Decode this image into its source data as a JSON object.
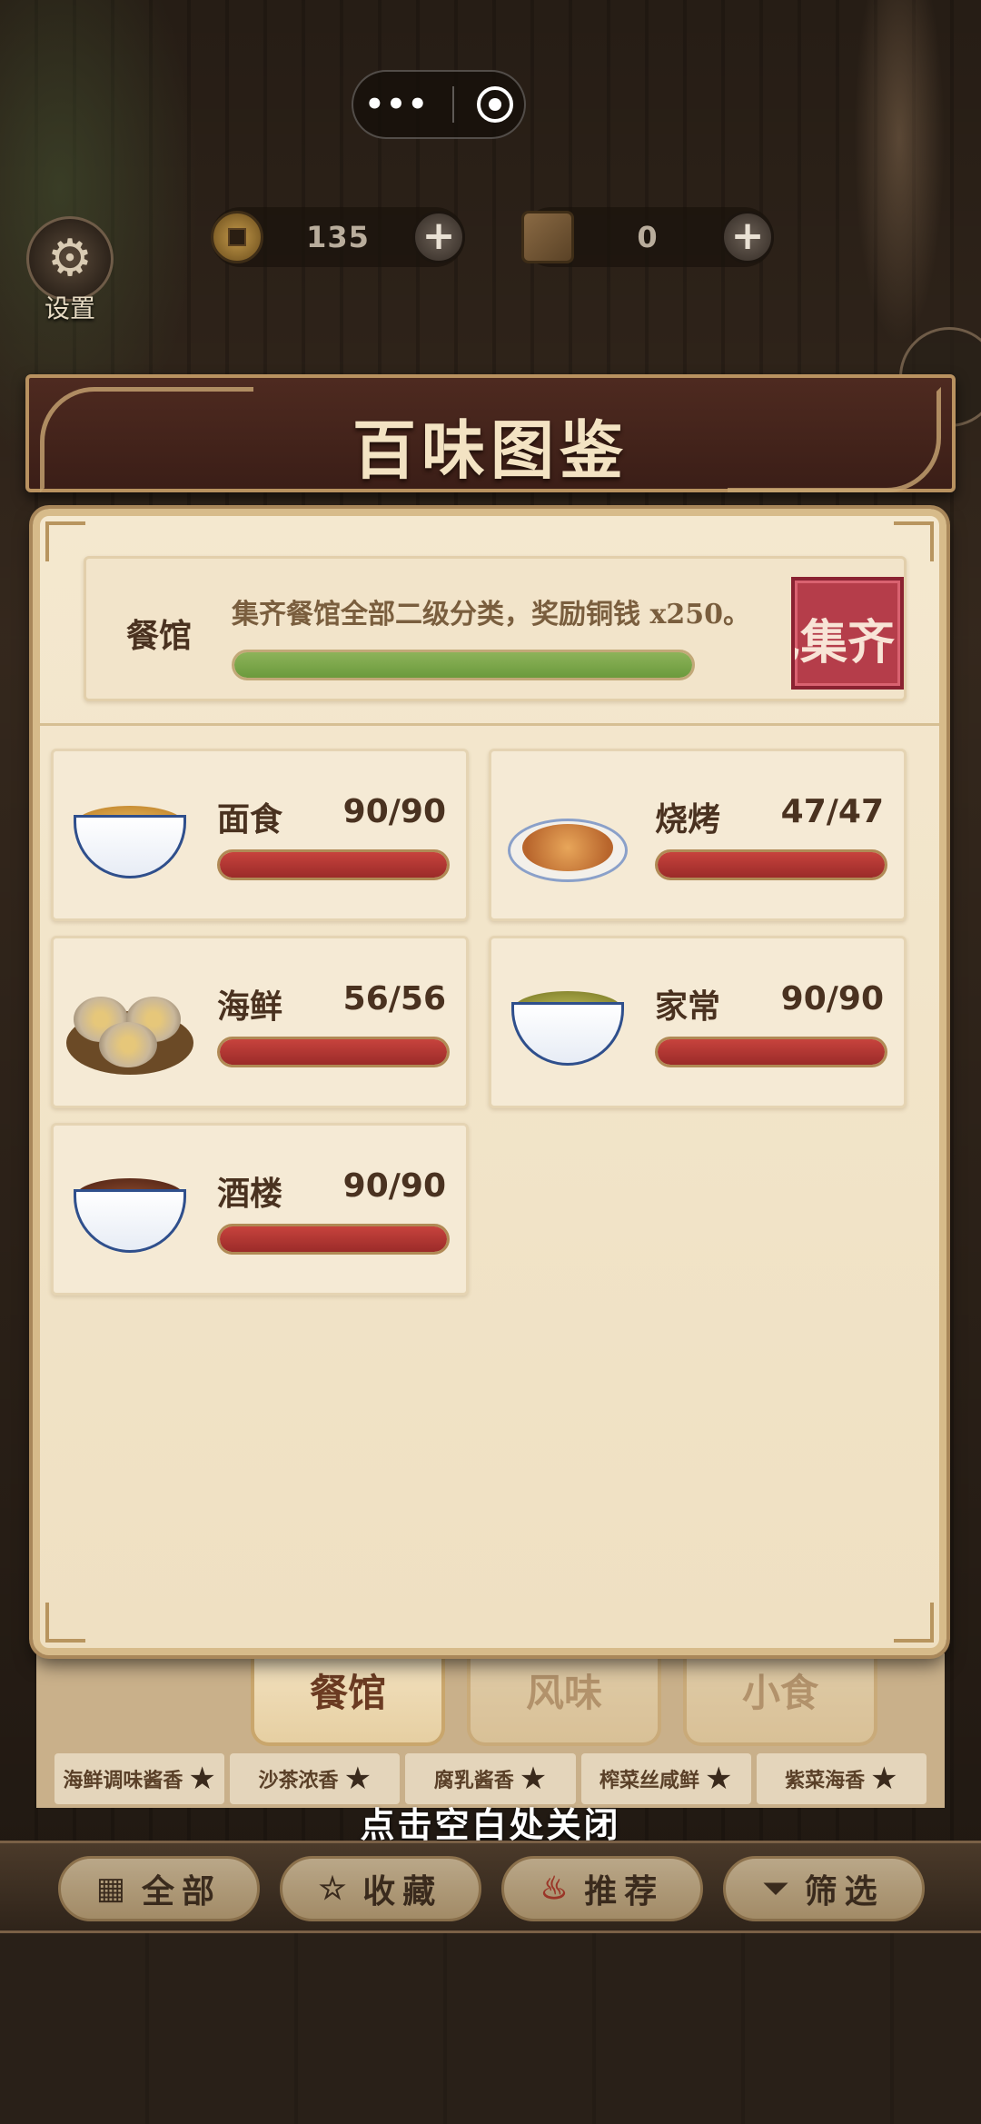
{
  "capsule": {
    "more_icon": "more-dots-icon",
    "close_icon": "target-close-icon"
  },
  "settings": {
    "label": "设置",
    "icon": "gear-icon"
  },
  "currency": {
    "coins": {
      "value": "135",
      "icon": "copper-coin-icon"
    },
    "books": {
      "value": "0",
      "icon": "recipe-book-icon"
    },
    "plus_label": "+"
  },
  "modal": {
    "title": "百味图鉴",
    "header": {
      "category": "餐馆",
      "description": "集齐餐馆全部二级分类，奖励铜钱 x250。",
      "progress": 1.0,
      "stamp_text": "已集齐"
    },
    "categories": [
      {
        "name": "面食",
        "count": "90/90",
        "progress": 1.0,
        "icon": "noodle-bowl-icon"
      },
      {
        "name": "烧烤",
        "count": "47/47",
        "progress": 1.0,
        "icon": "grilled-buns-icon"
      },
      {
        "name": "海鲜",
        "count": "56/56",
        "progress": 1.0,
        "icon": "oysters-icon"
      },
      {
        "name": "家常",
        "count": "90/90",
        "progress": 1.0,
        "icon": "pea-soup-bowl-icon"
      },
      {
        "name": "酒楼",
        "count": "90/90",
        "progress": 1.0,
        "icon": "bean-stew-bowl-icon"
      }
    ]
  },
  "under": {
    "tabs": [
      "餐馆",
      "风味",
      "小食"
    ],
    "dishes": [
      "海鲜调味酱香",
      "沙茶浓香",
      "腐乳酱香",
      "榨菜丝咸鲜",
      "紫菜海香"
    ],
    "close_hint": "点击空白处关闭",
    "bottom_buttons": [
      {
        "label": "全部",
        "icon": "grid-icon"
      },
      {
        "label": "收藏",
        "icon": "star-icon"
      },
      {
        "label": "推荐",
        "icon": "flame-icon"
      },
      {
        "label": "筛选",
        "icon": "filter-icon"
      }
    ]
  },
  "colors": {
    "accent_red": "#b53d4a",
    "progress_green": "#7aa64a",
    "progress_red": "#b03834",
    "title_bar": "#4e2a20",
    "parchment": "#f4e8cf"
  }
}
